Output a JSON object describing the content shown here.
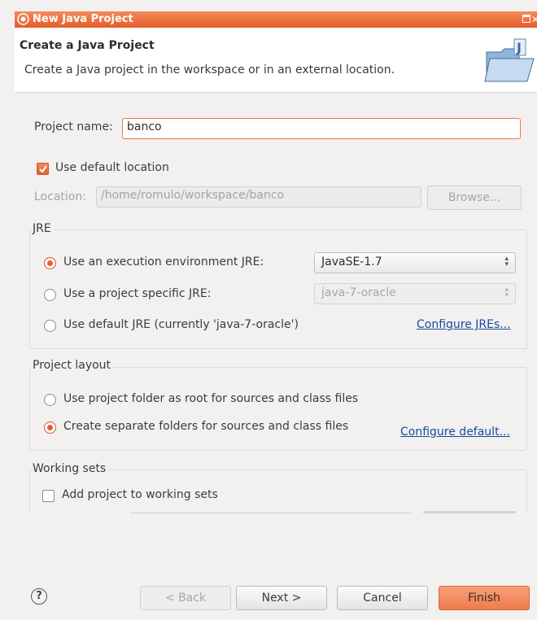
{
  "window": {
    "title": "New Java Project"
  },
  "header": {
    "title": "Create a Java Project",
    "description": "Create a Java project in the workspace or in an external location."
  },
  "project": {
    "name_label": "Project name:",
    "name_value": "banco",
    "use_default_location_label": "Use default location",
    "use_default_location_checked": true,
    "location_label": "Location:",
    "location_value": "/home/romulo/workspace/banco",
    "browse_label": "Browse..."
  },
  "jre": {
    "group_title": "JRE",
    "options": [
      {
        "label": "Use an execution environment JRE:",
        "selected": true
      },
      {
        "label": "Use a project specific JRE:",
        "selected": false
      },
      {
        "label": "Use default JRE (currently 'java-7-oracle')",
        "selected": false
      }
    ],
    "execution_env_value": "JavaSE-1.7",
    "project_specific_value": "java-7-oracle",
    "configure_link": "Configure JREs..."
  },
  "layout": {
    "group_title": "Project layout",
    "options": [
      {
        "label": "Use project folder as root for sources and class files",
        "selected": false
      },
      {
        "label": "Create separate folders for sources and class files",
        "selected": true
      }
    ],
    "configure_link": "Configure default..."
  },
  "working_sets": {
    "group_title": "Working sets",
    "add_label": "Add project to working sets",
    "add_checked": false
  },
  "footer": {
    "help_glyph": "?",
    "back_label": "< Back",
    "next_label": "Next >",
    "cancel_label": "Cancel",
    "finish_label": "Finish"
  },
  "colors": {
    "accent": "#e65f2b",
    "link": "#1a4a9a",
    "dialog_bg": "#f2f1f0"
  }
}
